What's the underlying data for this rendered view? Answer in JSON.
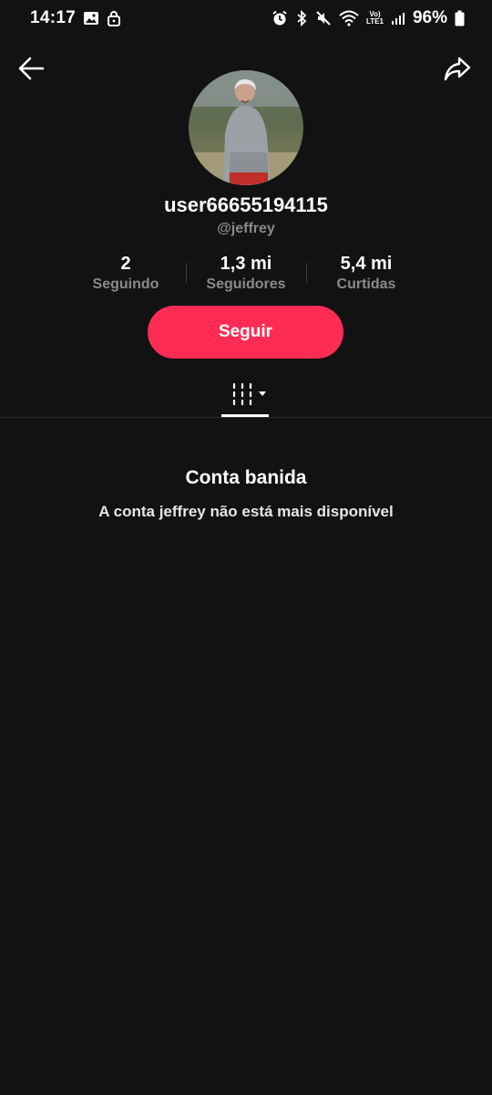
{
  "status_bar": {
    "time": "14:17",
    "battery": "96%",
    "lte_top": "Vo)",
    "lte_bottom": "LTE1"
  },
  "profile": {
    "username": "user66655194115",
    "handle": "@jeffrey"
  },
  "stats": [
    {
      "value": "2",
      "label": "Seguindo"
    },
    {
      "value": "1,3 mi",
      "label": "Seguidores"
    },
    {
      "value": "5,4 mi",
      "label": "Curtidas"
    }
  ],
  "actions": {
    "follow_label": "Seguir"
  },
  "banned": {
    "title": "Conta banida",
    "message": "A conta jeffrey não está mais disponível"
  },
  "colors": {
    "background": "#121212",
    "accent": "#fe2c55",
    "secondary_text": "#8a8a8a"
  },
  "icons": {
    "back": "arrow-left-icon",
    "share": "share-arrow-icon",
    "tab": "grid-columns-icon"
  }
}
